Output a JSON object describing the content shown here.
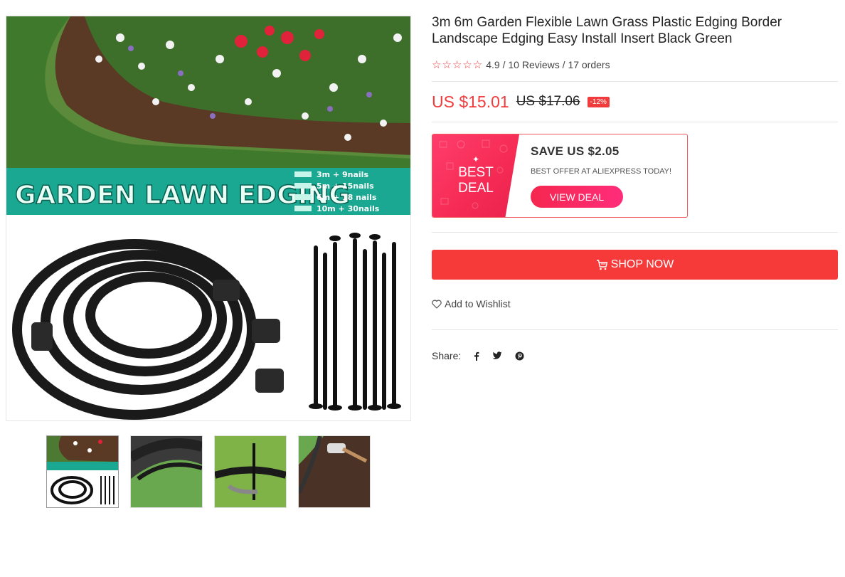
{
  "product": {
    "title": "3m 6m Garden Flexible Lawn Grass Plastic Edging Border Landscape Edging Easy Install Insert Black Green",
    "rating_value": "4.9",
    "rating_stars": "☆☆☆☆☆",
    "reviews": "10 Reviews",
    "orders": "17 orders",
    "price_now": "US $15.01",
    "price_old": "US $17.06",
    "discount": "-12%"
  },
  "deal": {
    "badge_line1": "BEST",
    "badge_line2": "DEAL",
    "save_text": "SAVE US $2.05",
    "note": "BEST OFFER AT ALIEXPRESS TODAY!",
    "button": "VIEW DEAL"
  },
  "actions": {
    "shop_now": "SHOP NOW",
    "wishlist": "Add to Wishlist",
    "share_label": "Share:",
    "share_icons": [
      "facebook-icon",
      "twitter-icon",
      "pinterest-icon"
    ]
  },
  "gallery": {
    "banner_text": "GARDEN LAWN EDGING",
    "options": [
      "3m + 9nails",
      "5m + 15nails",
      "6m + 18 nails",
      "10m + 30nails"
    ],
    "thumbs": [
      "thumb-product-banner",
      "thumb-edging-on-grass",
      "thumb-nail-in-grass",
      "thumb-hammer-install"
    ]
  },
  "colors": {
    "accent_red": "#f03c3c",
    "teal_banner": "#1aa892"
  }
}
